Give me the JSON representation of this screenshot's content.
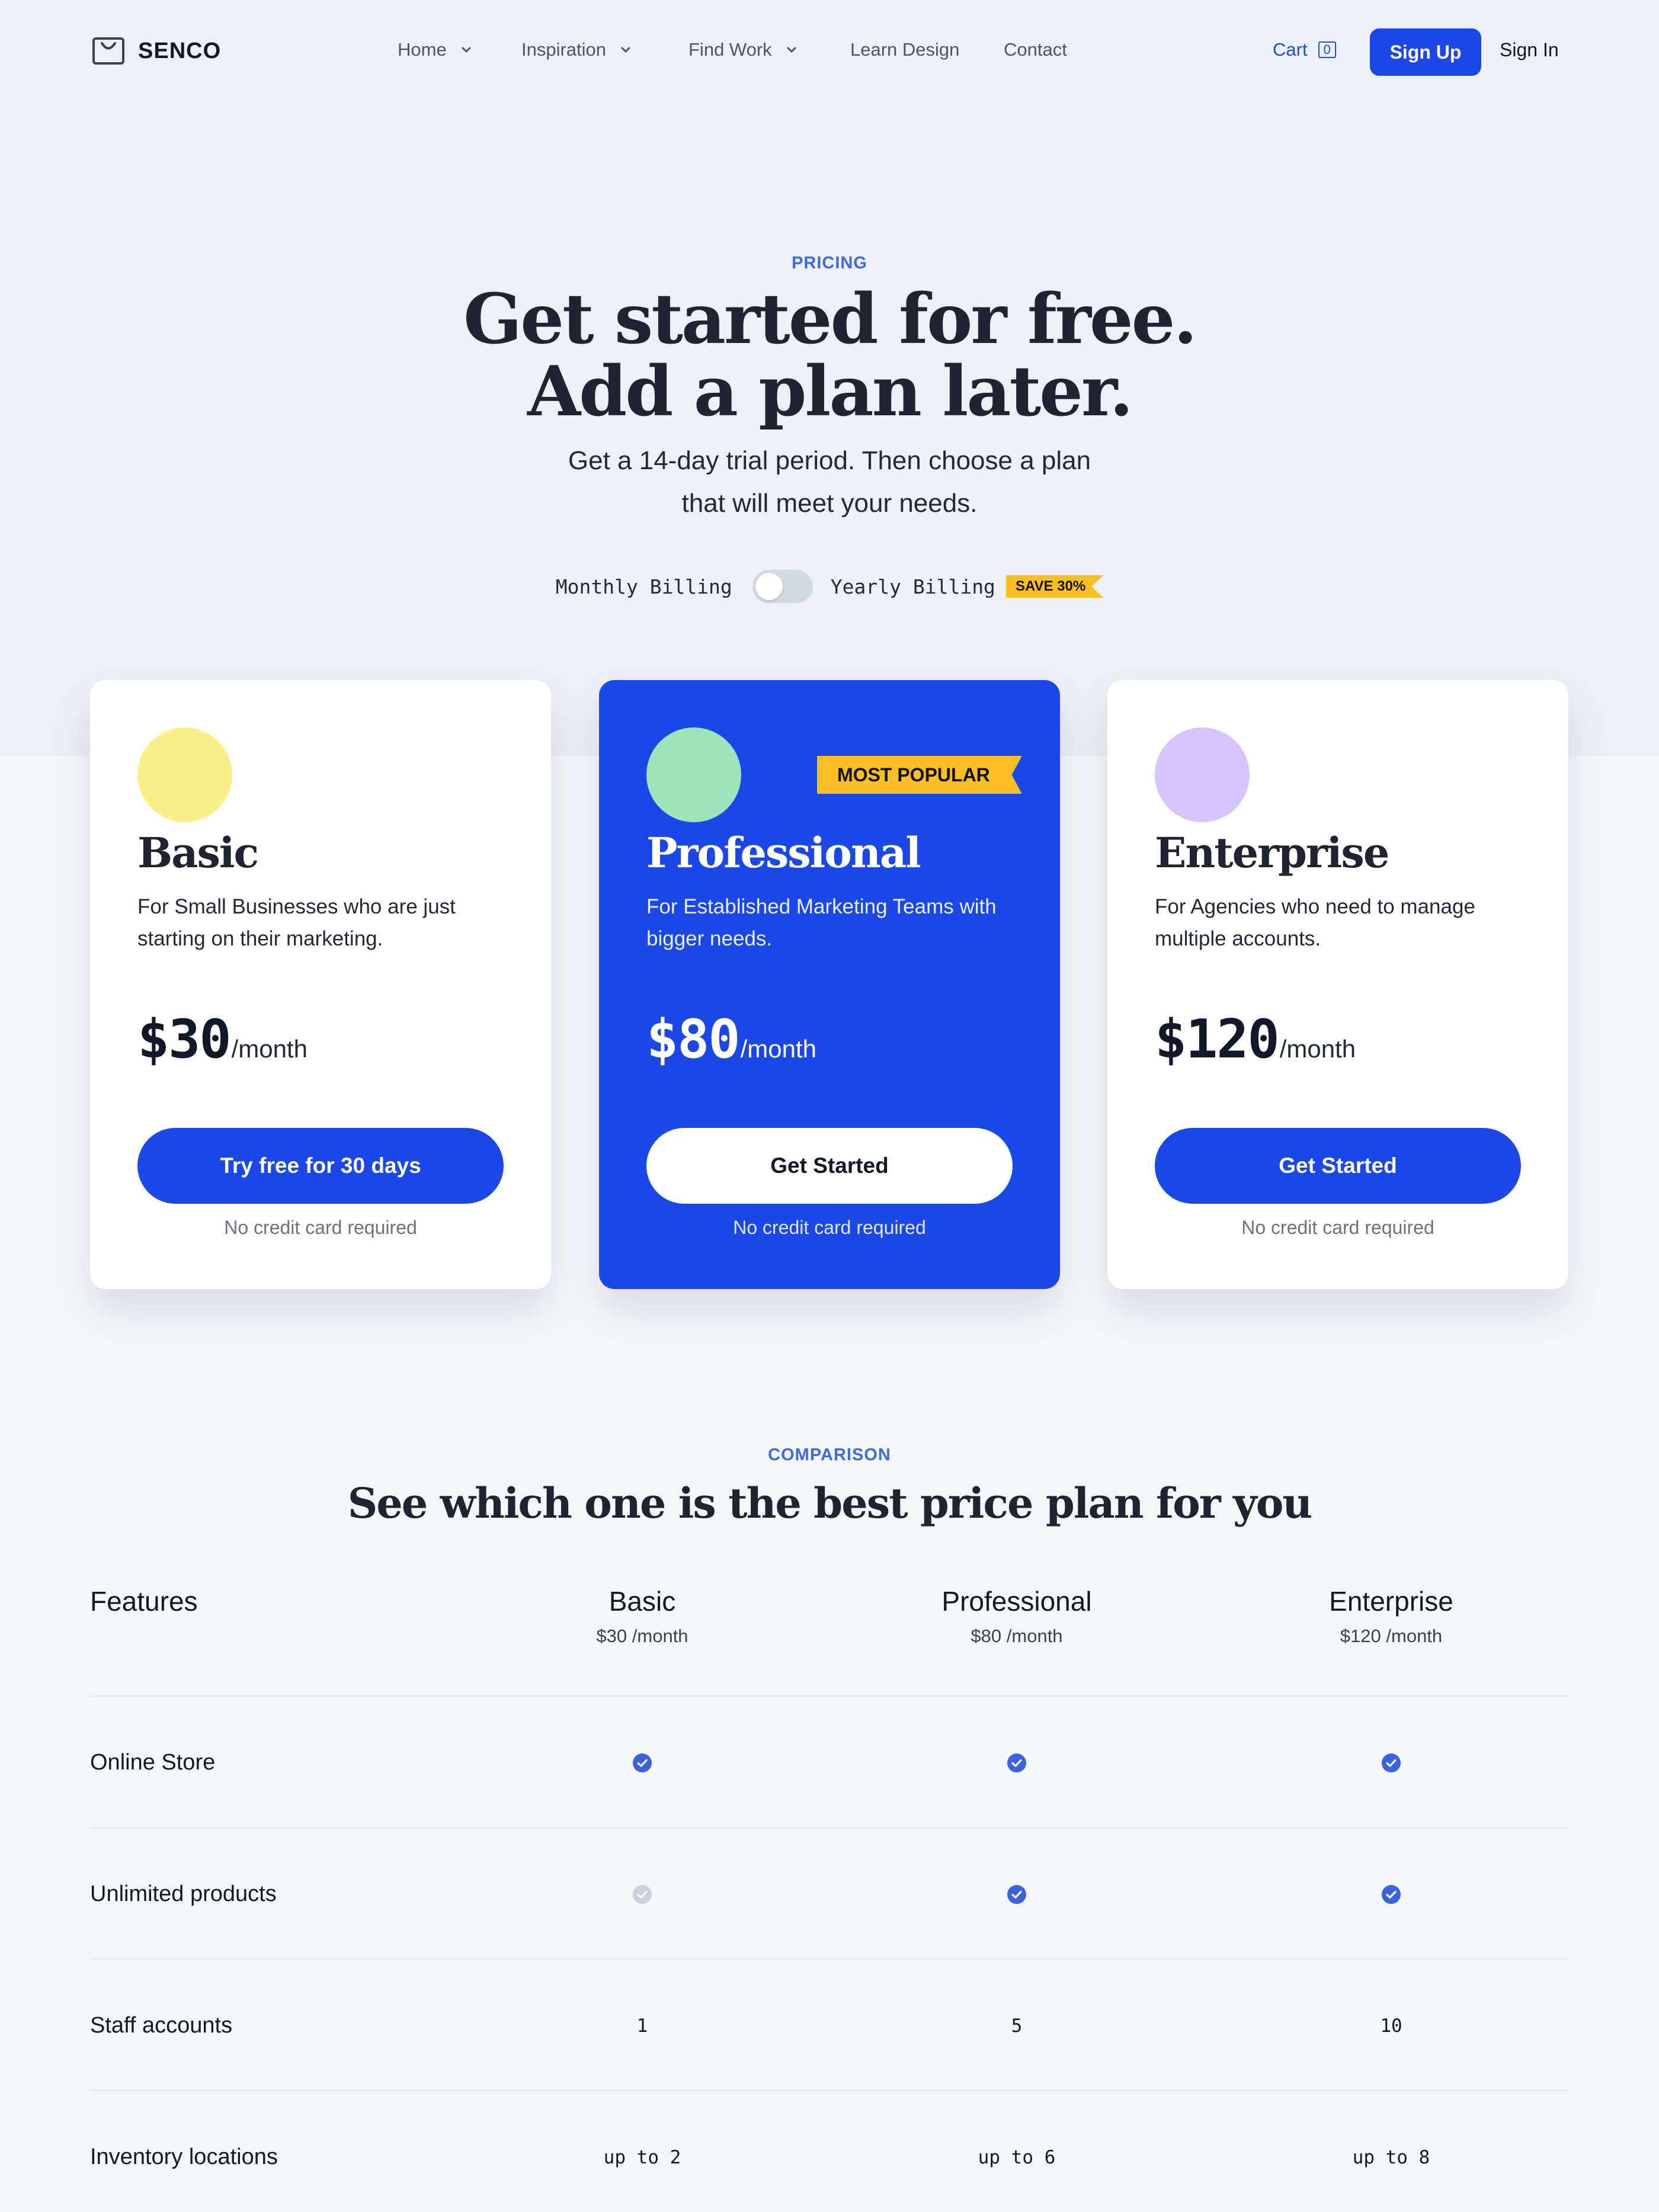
{
  "brand": {
    "name": "SENCO"
  },
  "nav": {
    "items": [
      {
        "label": "Home"
      },
      {
        "label": "Inspiration"
      },
      {
        "label": "Find Work"
      },
      {
        "label": "Learn Design"
      },
      {
        "label": "Contact"
      }
    ],
    "cart_label": "Cart",
    "cart_count": "0",
    "signup_label": "Sign Up",
    "signin_label": "Sign In"
  },
  "hero": {
    "eyebrow": "PRICING",
    "title_line1": "Get started for free.",
    "title_line2": "Add a plan later.",
    "subtitle_line1": "Get a 14-day trial period. Then choose a plan",
    "subtitle_line2": "that will meet your needs.",
    "billing_monthly": "Monthly Billing",
    "billing_yearly": "Yearly Billing",
    "billing_yearly_selected": false,
    "save_badge": "SAVE 30%"
  },
  "plans": [
    {
      "name": "Basic",
      "description": "For Small Businesses who are just starting on their marketing.",
      "price": "$30",
      "period": "/month",
      "cta": "Try free for 30 days",
      "note": "No credit card required",
      "dot_color": "#faf08a",
      "featured": false
    },
    {
      "name": "Professional",
      "description": "For Established Marketing Teams with bigger needs.",
      "price": "$80",
      "period": "/month",
      "cta": "Get Started",
      "note": "No credit card required",
      "dot_color": "#9de5b8",
      "featured": true,
      "badge": "MOST POPULAR"
    },
    {
      "name": "Enterprise",
      "description": "For Agencies who need to manage multiple accounts.",
      "price": "$120",
      "period": "/month",
      "cta": "Get Started",
      "note": "No credit card required",
      "dot_color": "#d8c3fb",
      "featured": false
    }
  ],
  "comparison": {
    "eyebrow": "COMPARISON",
    "title": "See which one is the best price plan for you",
    "features_header": "Features",
    "columns": [
      {
        "name": "Basic",
        "price": "$30 /month"
      },
      {
        "name": "Professional",
        "price": "$80 /month"
      },
      {
        "name": "Enterprise",
        "price": "$120 /month"
      }
    ],
    "rows": [
      {
        "label": "Online Store",
        "values": [
          "check",
          "check",
          "check"
        ]
      },
      {
        "label": "Unlimited products",
        "values": [
          "check-disabled",
          "check",
          "check"
        ]
      },
      {
        "label": "Staff accounts",
        "values": [
          "1",
          "5",
          "10"
        ]
      },
      {
        "label": "Inventory locations",
        "values": [
          "up to 2",
          "up to 6",
          "up to 8"
        ]
      }
    ]
  },
  "colors": {
    "accent": "#1a47e6",
    "highlight": "#fbbf24",
    "check_active": "#3b63e0",
    "check_disabled": "#c9d1dc"
  }
}
